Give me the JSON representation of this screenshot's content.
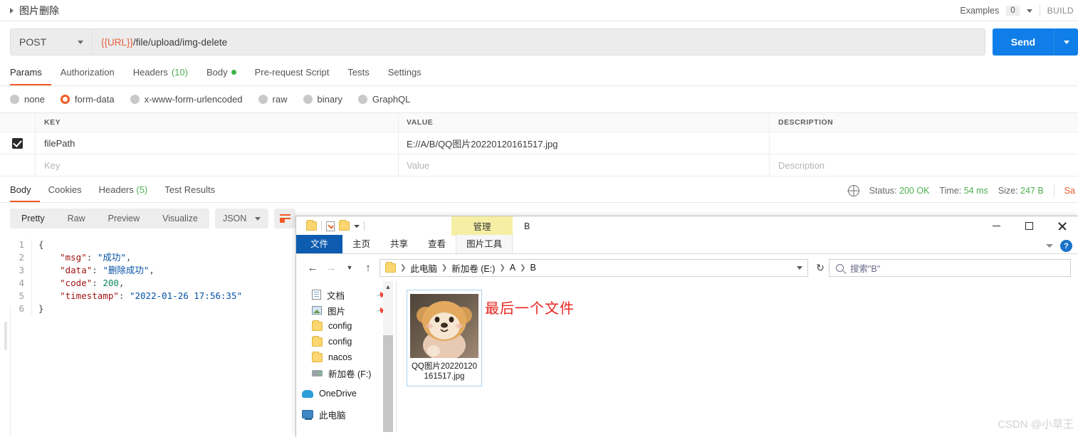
{
  "postman": {
    "request_tab": {
      "title": "图片删除",
      "collapse_icon": "triangle-right-icon"
    },
    "examples": {
      "label": "Examples",
      "count": "0"
    },
    "build_label": "BUILD",
    "method": "POST",
    "url_prefix": "{{URL}}",
    "url_path": "/file/upload/img-delete",
    "send_label": "Send",
    "request_tabs": [
      {
        "label": "Params",
        "active": false
      },
      {
        "label": "Authorization",
        "active": false
      },
      {
        "label": "Headers",
        "count": "(10)",
        "active": false
      },
      {
        "label": "Body",
        "active": true,
        "dot": true
      },
      {
        "label": "Pre-request Script",
        "active": false
      },
      {
        "label": "Tests",
        "active": false
      },
      {
        "label": "Settings",
        "active": false
      }
    ],
    "body_types": [
      {
        "label": "none",
        "selected": false
      },
      {
        "label": "form-data",
        "selected": true
      },
      {
        "label": "x-www-form-urlencoded",
        "selected": false
      },
      {
        "label": "raw",
        "selected": false
      },
      {
        "label": "binary",
        "selected": false
      },
      {
        "label": "GraphQL",
        "selected": false
      }
    ],
    "form_table": {
      "headers": {
        "key": "KEY",
        "value": "VALUE",
        "description": "DESCRIPTION"
      },
      "rows": [
        {
          "checked": true,
          "key": "filePath",
          "value": "E://A/B/QQ图片20220120161517.jpg",
          "description": ""
        }
      ],
      "placeholders": {
        "key": "Key",
        "value": "Value",
        "description": "Description"
      }
    },
    "response": {
      "tabs": [
        {
          "label": "Body",
          "active": true
        },
        {
          "label": "Cookies",
          "active": false
        },
        {
          "label": "Headers",
          "count": "(5)",
          "active": false
        },
        {
          "label": "Test Results",
          "active": false
        }
      ],
      "status_label": "Status:",
      "status_value": "200 OK",
      "time_label": "Time:",
      "time_value": "54 ms",
      "size_label": "Size:",
      "size_value": "247 B",
      "save_label": "Sa",
      "view_modes": [
        {
          "label": "Pretty",
          "active": true
        },
        {
          "label": "Raw",
          "active": false
        },
        {
          "label": "Preview",
          "active": false
        },
        {
          "label": "Visualize",
          "active": false
        }
      ],
      "format": "JSON",
      "line_numbers": [
        "1",
        "2",
        "3",
        "4",
        "5",
        "6"
      ],
      "json_lines": [
        {
          "indent": 0,
          "parts": [
            {
              "t": "{",
              "c": "cp"
            }
          ]
        },
        {
          "indent": 1,
          "parts": [
            {
              "t": "\"msg\"",
              "c": "ck"
            },
            {
              "t": ": ",
              "c": "cp"
            },
            {
              "t": "\"成功\"",
              "c": "cs"
            },
            {
              "t": ",",
              "c": "cp"
            }
          ]
        },
        {
          "indent": 1,
          "parts": [
            {
              "t": "\"data\"",
              "c": "ck"
            },
            {
              "t": ": ",
              "c": "cp"
            },
            {
              "t": "\"删除成功\"",
              "c": "cs"
            },
            {
              "t": ",",
              "c": "cp"
            }
          ]
        },
        {
          "indent": 1,
          "parts": [
            {
              "t": "\"code\"",
              "c": "ck"
            },
            {
              "t": ": ",
              "c": "cp"
            },
            {
              "t": "200",
              "c": "cn"
            },
            {
              "t": ",",
              "c": "cp"
            }
          ]
        },
        {
          "indent": 1,
          "parts": [
            {
              "t": "\"timestamp\"",
              "c": "ck"
            },
            {
              "t": ": ",
              "c": "cp"
            },
            {
              "t": "\"2022-01-26 17:56:35\"",
              "c": "cs"
            }
          ]
        },
        {
          "indent": 0,
          "parts": [
            {
              "t": "}",
              "c": "cp"
            }
          ]
        }
      ]
    }
  },
  "explorer": {
    "window_title": "B",
    "ribbon_context": "管理",
    "quick_access": [
      "folder-icon",
      "properties-icon",
      "new-folder-icon",
      "customize-caret-icon"
    ],
    "ribbon_tabs": [
      {
        "label": "文件",
        "type": "file"
      },
      {
        "label": "主页",
        "type": "normal"
      },
      {
        "label": "共享",
        "type": "normal"
      },
      {
        "label": "查看",
        "type": "normal"
      },
      {
        "label": "图片工具",
        "type": "context"
      }
    ],
    "help_label": "?",
    "breadcrumb": [
      "此电脑",
      "新加卷 (E:)",
      "A",
      "B"
    ],
    "search_placeholder": "搜索\"B\"",
    "nav_items": [
      {
        "label": "文档",
        "icon": "document-icon",
        "pinned": true,
        "root": false
      },
      {
        "label": "图片",
        "icon": "picture-icon",
        "pinned": true,
        "root": false
      },
      {
        "label": "config",
        "icon": "folder-icon",
        "pinned": false,
        "root": false
      },
      {
        "label": "config",
        "icon": "folder-icon",
        "pinned": false,
        "root": false
      },
      {
        "label": "nacos",
        "icon": "folder-icon",
        "pinned": false,
        "root": false
      },
      {
        "label": "新加卷 (F:)",
        "icon": "drive-icon",
        "pinned": false,
        "root": false
      },
      {
        "label": "OneDrive",
        "icon": "onedrive-icon",
        "pinned": false,
        "root": true
      },
      {
        "label": "此电脑",
        "icon": "this-pc-icon",
        "pinned": false,
        "root": true
      }
    ],
    "files": [
      {
        "name": "QQ图片20220120161517.jpg",
        "selected": true
      }
    ],
    "annotation": "最后一个文件"
  },
  "watermark": "CSDN @小草王"
}
